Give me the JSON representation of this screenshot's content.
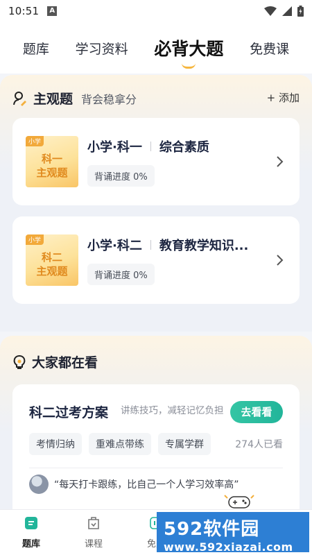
{
  "status_bar": {
    "time": "10:51",
    "notification_icon": "A"
  },
  "top_tabs": [
    {
      "label": "题库",
      "active": false
    },
    {
      "label": "学习资料",
      "active": false
    },
    {
      "label": "必背大题",
      "active": true
    },
    {
      "label": "免费课",
      "active": false
    }
  ],
  "subjective": {
    "title": "主观题",
    "subtitle": "背会稳拿分",
    "add_label": "+ 添加",
    "cards": [
      {
        "cover_tag": "小学",
        "cover_line1": "科一",
        "cover_line2": "主观题",
        "title": "小学·科一",
        "title2": "综合素质",
        "progress": "背诵进度 0%"
      },
      {
        "cover_tag": "小学",
        "cover_line1": "科二",
        "cover_line2": "主观题",
        "title": "小学·科二",
        "title2": "教育教学知识...",
        "progress": "背诵进度 0%"
      }
    ]
  },
  "watching": {
    "title": "大家都在看",
    "plan_title": "科二过考方案",
    "plan_desc": "讲练技巧，减轻记忆负担",
    "button": "去看看",
    "chips": [
      "考情归纳",
      "重难点带练",
      "专属学群"
    ],
    "viewers": "274人已看",
    "quote": "“每天打卡跟练，比自己一个人学习效率高”"
  },
  "bottom_nav": [
    {
      "label": "题库",
      "active": true
    },
    {
      "label": "课程",
      "active": false
    },
    {
      "label": "免费",
      "active": false
    }
  ],
  "watermark": {
    "main": "592软件园",
    "sub": "www.592xiazai.com"
  },
  "colors": {
    "accent_green": "#22b59a",
    "cover_orange": "#e08a1e",
    "watermark_blue": "#2d7fd4"
  }
}
